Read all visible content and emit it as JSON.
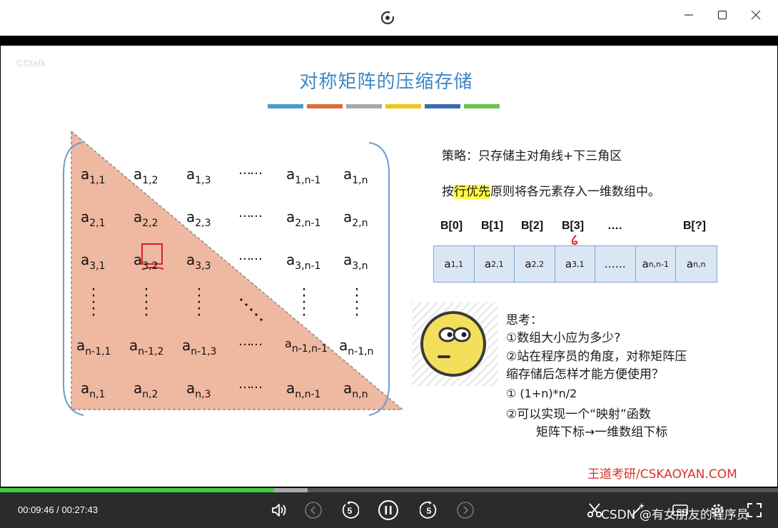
{
  "window": {
    "logo_icon": "player-logo-icon",
    "min_icon": "minimize-icon",
    "max_icon": "maximize-icon",
    "close_icon": "close-icon"
  },
  "slide": {
    "watermark": "CCtalk",
    "title": "对称矩阵的压缩存储",
    "title_bar_colors": [
      "#4a9bd1",
      "#dd6e3c",
      "#a8a8a8",
      "#f0c419",
      "#3b6db5",
      "#6cc24a"
    ],
    "matrix": {
      "rows": [
        [
          "a1,1",
          "a1,2",
          "a1,3",
          "……",
          "a1,n-1",
          "a1,n"
        ],
        [
          "a2,1",
          "a2,2",
          "a2,3",
          "……",
          "a2,n-1",
          "a2,n"
        ],
        [
          "a3,1",
          "a3,2",
          "a3,3",
          "……",
          "a3,n-1",
          "a3,n"
        ],
        [
          "an-1,1",
          "an-1,2",
          "an-1,3",
          "……",
          "an-1,n-1",
          "an-1,n"
        ],
        [
          "an,1",
          "an,2",
          "an,3",
          "……",
          "an,n-1",
          "an,n"
        ]
      ],
      "triangle_color": "#efb8a1",
      "annotation_color": "#e02020"
    },
    "strategy": "策略：只存储主对角线+下三角区",
    "principle_before": "按",
    "principle_highlight": "行优先",
    "principle_after": "原则将各元素存入一维数组中。",
    "array_labels": [
      "B[0]",
      "B[1]",
      "B[2]",
      "B[3]",
      "….",
      "B[?]"
    ],
    "array_cells": [
      "a1,1",
      "a2,1",
      "a2,2",
      "a3,1",
      "……",
      "an,n-1",
      "an,n"
    ],
    "think_title": "思考：",
    "think_q1": "①数组大小应为多少?",
    "think_q2_l1": "②站在程序员的角度，对称矩阵压",
    "think_q2_l2": "缩存储后怎样才能方便使用？",
    "answer1": "① (1+n)*n/2",
    "answer2_l1": "②可以实现一个“映射”函数",
    "answer2_l2": "矩阵下标→一维数组下标",
    "brand": "王道考研/CSKAOYAN.COM"
  },
  "player": {
    "current_time": "00:09:46",
    "separator": "/",
    "duration": "00:27:43",
    "progress_played": 0.352,
    "progress_buffered": 0.395,
    "icons": [
      "volume-icon",
      "prev-icon",
      "rewind-5-icon",
      "pause-icon",
      "forward-5-icon",
      "next-icon",
      "scissors-icon",
      "magic-icon",
      "subtitle-icon",
      "settings-icon",
      "fullscreen-icon"
    ],
    "watermark": "CSDN @有女朋友的程序员"
  }
}
